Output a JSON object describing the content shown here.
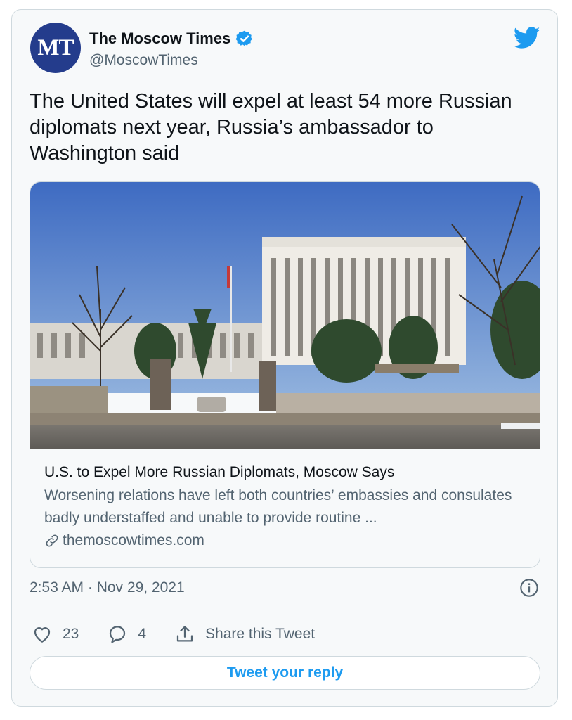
{
  "author": {
    "avatar_text": "MT",
    "name": "The Moscow Times",
    "handle": "@MoscowTimes",
    "verified": true
  },
  "tweet": {
    "text": "The United States will expel at least 54 more Russian diplomats next year, Russia’s ambassador to Washington said",
    "timestamp": "2:53 AM · Nov 29, 2021"
  },
  "link_card": {
    "image_alt": "Russian embassy building in Washington",
    "title": "U.S. to Expel More Russian Diplomats, Moscow Says",
    "description": "Worsening relations have left both countries’ embassies and consulates badly understaffed and unable to provide routine ...",
    "domain": "themoscowtimes.com"
  },
  "actions": {
    "like_count": "23",
    "reply_count": "4",
    "share_label": "Share this Tweet"
  },
  "reply_button": {
    "label": "Tweet your reply"
  },
  "icons": {
    "logo": "twitter-bird-icon",
    "verified": "verified-badge-icon",
    "info": "info-icon",
    "like": "heart-icon",
    "reply": "reply-bubble-icon",
    "share": "share-icon",
    "link": "link-icon"
  },
  "colors": {
    "accent": "#1d9bf0",
    "text_primary": "#0f1419",
    "text_secondary": "#536471",
    "border": "#cfd9de",
    "avatar_bg": "#243c8c"
  }
}
